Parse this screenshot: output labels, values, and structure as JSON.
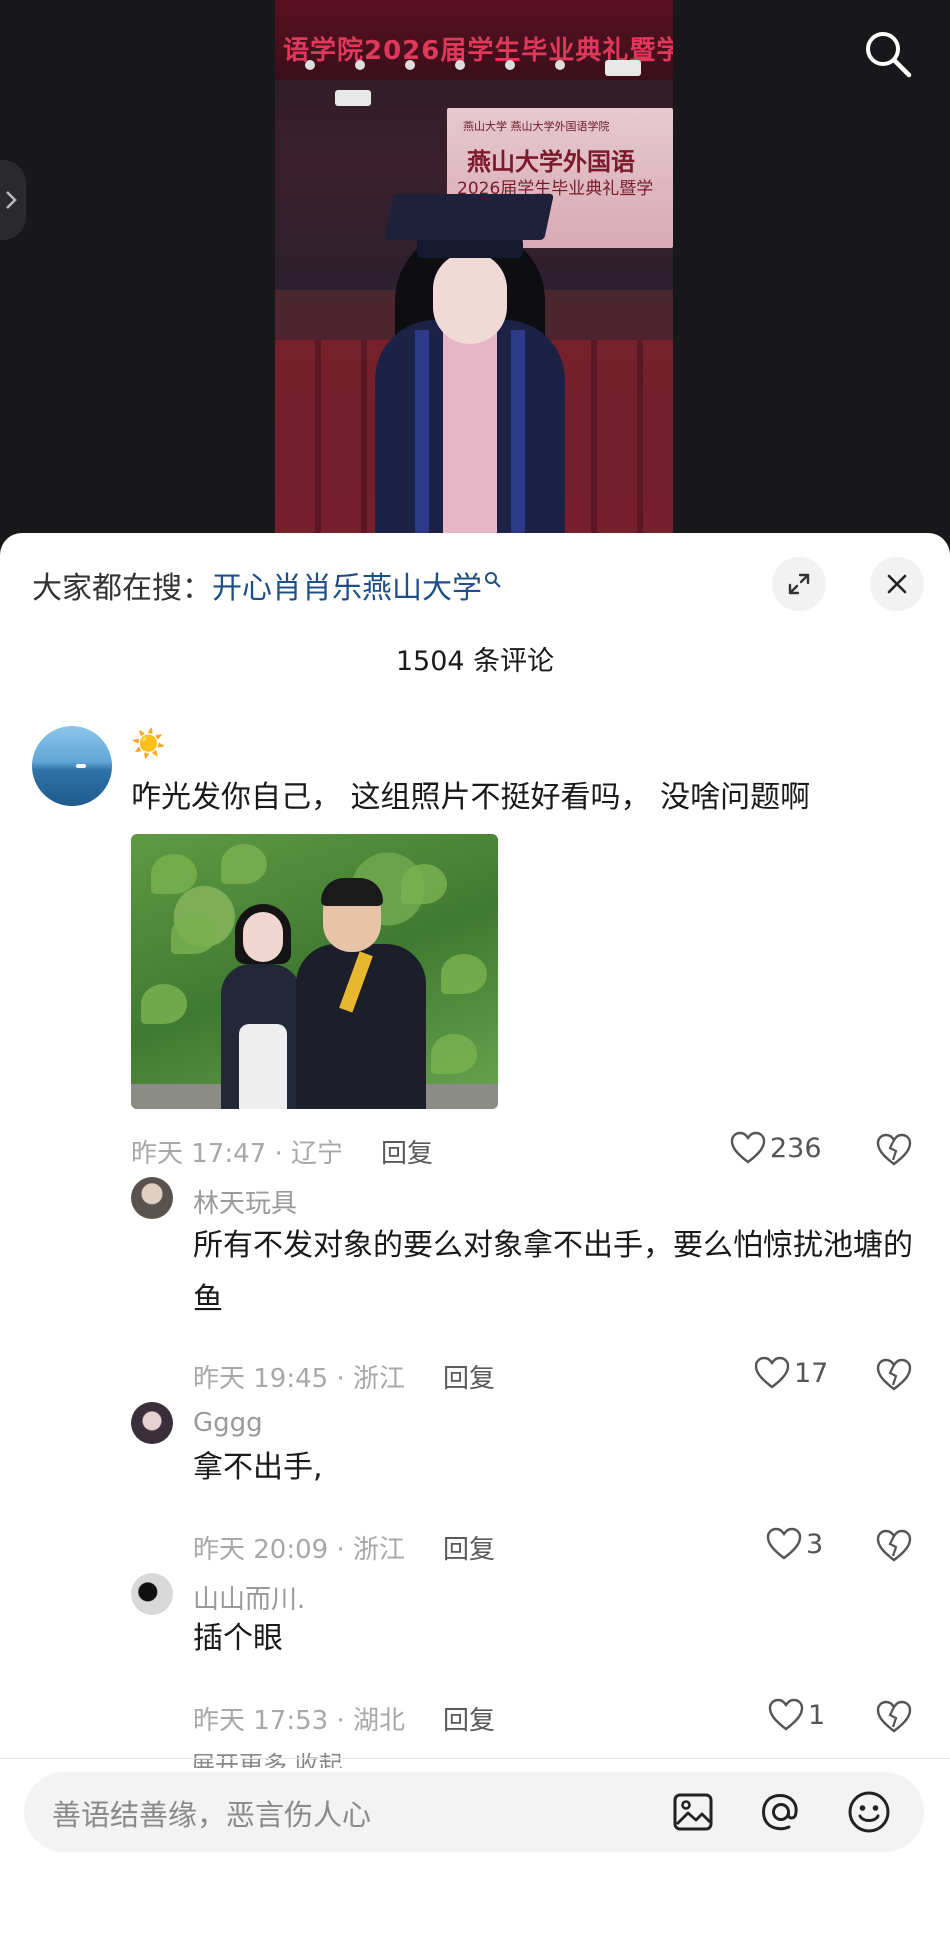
{
  "video": {
    "banner_text": "语学院2026届学生毕业典礼暨学",
    "screen_logo": "燕山大学 燕山大学外国语学院",
    "screen_line1": "燕山大学外国语",
    "screen_line2": "2026届学生毕业典礼暨学"
  },
  "hot_search": {
    "prefix": "大家都在搜：",
    "query": "开心肖肖乐燕山大学"
  },
  "comment_count": "1504 条评论",
  "comments": [
    {
      "emoji": "☀️",
      "text": "咋光发你自己， 这组照片不挺好看吗， 没啥问题啊",
      "time_location": "昨天 17:47 · 辽宁",
      "reply_label": "回复",
      "likes": "236"
    }
  ],
  "replies": [
    {
      "name": "林天玩具",
      "text": "所有不发对象的要么对象拿不出手，要么怕惊扰池塘的鱼",
      "time_location": "昨天 19:45 · 浙江",
      "reply_label": "回复",
      "likes": "17"
    },
    {
      "name": "Gggg",
      "text": "拿不出手,",
      "time_location": "昨天 20:09 · 浙江",
      "reply_label": "回复",
      "likes": "3"
    },
    {
      "name": "山山而川.",
      "text": "插个眼",
      "time_location": "昨天 17:53 · 湖北",
      "reply_label": "回复",
      "likes": "1"
    }
  ],
  "more_row": "展开更多 收起",
  "input": {
    "placeholder": "善语结善缘，恶言伤人心"
  },
  "colors": {
    "link_blue": "#1e4f86",
    "text_dark": "#1a1a1a",
    "meta_gray": "#a8a8a8"
  },
  "icons": [
    "search-icon",
    "chevron-right-icon",
    "magnifier-icon",
    "expand-icon",
    "close-icon",
    "heart-icon",
    "broken-heart-icon",
    "image-icon",
    "at-icon",
    "emoji-icon"
  ]
}
